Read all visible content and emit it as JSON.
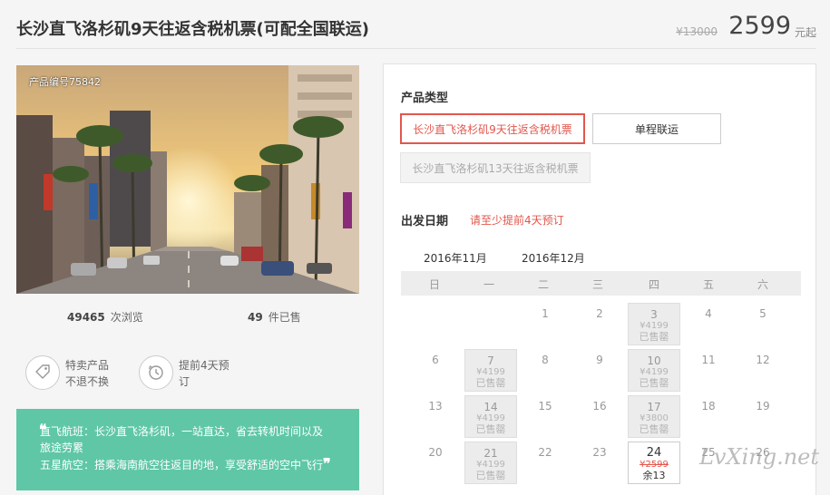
{
  "header": {
    "title": "长沙直飞洛杉矶9天往返含税机票(可配全国联运)",
    "old_price": "¥13000",
    "price": "2599",
    "price_suffix": "元起"
  },
  "photo": {
    "product_code": "产品编号75842"
  },
  "stats": {
    "views_count": "49465",
    "views_label": "次浏览",
    "sold_count": "49",
    "sold_label": "件已售"
  },
  "features": [
    {
      "icon": "tag-icon",
      "line1": "特卖产品",
      "line2": "不退不换"
    },
    {
      "icon": "clock-icon",
      "line1": "提前4天预",
      "line2": "订"
    }
  ],
  "promo": {
    "open_quote": "❝",
    "line1": "直飞航班：长沙直飞洛杉矶，一站直达，省去转机时间以及",
    "line2": "旅途劳累",
    "line3": "五星航空：搭乘海南航空往返目的地，享受舒适的空中飞行",
    "close_quote": "❞"
  },
  "product_type": {
    "label": "产品类型",
    "options": [
      {
        "label": "长沙直飞洛杉矶9天往返含税机票",
        "state": "selected"
      },
      {
        "label": "单程联运",
        "state": "normal"
      },
      {
        "label": "长沙直飞洛杉矶13天往返含税机票",
        "state": "disabled"
      }
    ]
  },
  "departure": {
    "label": "出发日期",
    "note": "请至少提前4天预订"
  },
  "months": [
    "2016年11月",
    "2016年12月"
  ],
  "weekdays": [
    "日",
    "一",
    "二",
    "三",
    "四",
    "五",
    "六"
  ],
  "calendar": {
    "rows": [
      [
        {
          "day": ""
        },
        {
          "day": ""
        },
        {
          "day": "1"
        },
        {
          "day": "2"
        },
        {
          "day": "3",
          "price": "¥4199",
          "status": "已售罄",
          "state": "sold"
        },
        {
          "day": "4"
        },
        {
          "day": "5"
        }
      ],
      [
        {
          "day": "6"
        },
        {
          "day": "7",
          "price": "¥4199",
          "status": "已售罄",
          "state": "sold"
        },
        {
          "day": "8"
        },
        {
          "day": "9"
        },
        {
          "day": "10",
          "price": "¥4199",
          "status": "已售罄",
          "state": "sold"
        },
        {
          "day": "11"
        },
        {
          "day": "12"
        }
      ],
      [
        {
          "day": "13"
        },
        {
          "day": "14",
          "price": "¥4199",
          "status": "已售罄",
          "state": "sold"
        },
        {
          "day": "15"
        },
        {
          "day": "16"
        },
        {
          "day": "17",
          "price": "¥3800",
          "status": "已售罄",
          "state": "sold"
        },
        {
          "day": "18"
        },
        {
          "day": "19"
        }
      ],
      [
        {
          "day": "20"
        },
        {
          "day": "21",
          "price": "¥4199",
          "status": "已售罄",
          "state": "sold"
        },
        {
          "day": "22"
        },
        {
          "day": "23"
        },
        {
          "day": "24",
          "price": "¥2599",
          "status": "余13",
          "state": "avail"
        },
        {
          "day": "25"
        },
        {
          "day": "26"
        }
      ]
    ]
  },
  "watermark": "LvXing.net",
  "colors": {
    "accent": "#e2574c",
    "promo_bg": "#5fc7a6"
  }
}
